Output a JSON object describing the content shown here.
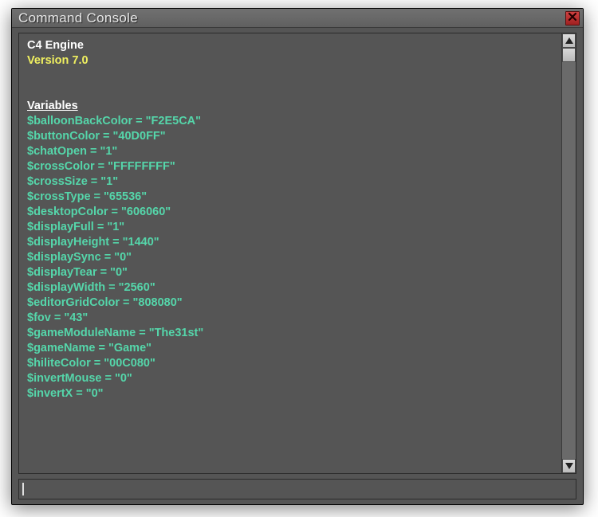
{
  "window": {
    "title": "Command Console"
  },
  "header": {
    "engine": "C4 Engine",
    "version": "Version 7.0",
    "section": "Variables"
  },
  "variables": [
    {
      "name": "$balloonBackColor",
      "value": "F2E5CA"
    },
    {
      "name": "$buttonColor",
      "value": "40D0FF"
    },
    {
      "name": "$chatOpen",
      "value": "1"
    },
    {
      "name": "$crossColor",
      "value": "FFFFFFFF"
    },
    {
      "name": "$crossSize",
      "value": "1"
    },
    {
      "name": "$crossType",
      "value": "65536"
    },
    {
      "name": "$desktopColor",
      "value": "606060"
    },
    {
      "name": "$displayFull",
      "value": "1"
    },
    {
      "name": "$displayHeight",
      "value": "1440"
    },
    {
      "name": "$displaySync",
      "value": "0"
    },
    {
      "name": "$displayTear",
      "value": "0"
    },
    {
      "name": "$displayWidth",
      "value": "2560"
    },
    {
      "name": "$editorGridColor",
      "value": "808080"
    },
    {
      "name": "$fov",
      "value": "43"
    },
    {
      "name": "$gameModuleName",
      "value": "The31st"
    },
    {
      "name": "$gameName",
      "value": "Game"
    },
    {
      "name": "$hiliteColor",
      "value": "00C080"
    },
    {
      "name": "$invertMouse",
      "value": "0"
    },
    {
      "name": "$invertX",
      "value": "0"
    }
  ],
  "input": {
    "value": "",
    "placeholder": ""
  }
}
